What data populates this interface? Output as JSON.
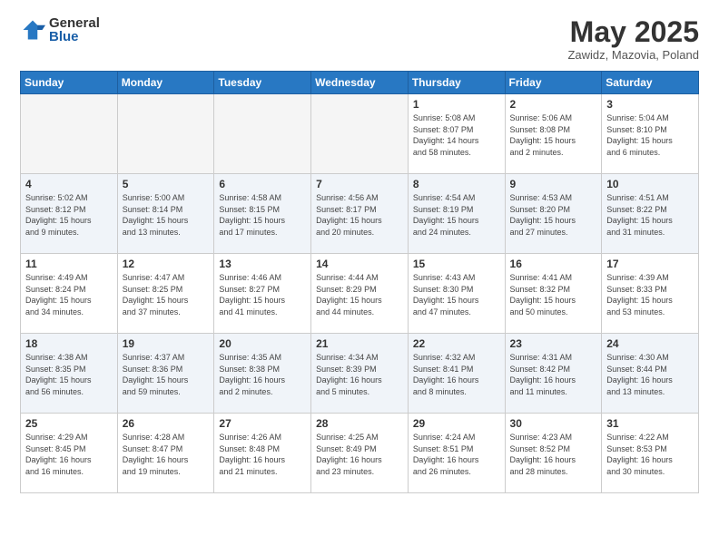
{
  "logo": {
    "general": "General",
    "blue": "Blue"
  },
  "title": "May 2025",
  "subtitle": "Zawidz, Mazovia, Poland",
  "days_header": [
    "Sunday",
    "Monday",
    "Tuesday",
    "Wednesday",
    "Thursday",
    "Friday",
    "Saturday"
  ],
  "weeks": [
    [
      {
        "day": "",
        "info": "",
        "empty": true
      },
      {
        "day": "",
        "info": "",
        "empty": true
      },
      {
        "day": "",
        "info": "",
        "empty": true
      },
      {
        "day": "",
        "info": "",
        "empty": true
      },
      {
        "day": "1",
        "info": "Sunrise: 5:08 AM\nSunset: 8:07 PM\nDaylight: 14 hours\nand 58 minutes.",
        "empty": false
      },
      {
        "day": "2",
        "info": "Sunrise: 5:06 AM\nSunset: 8:08 PM\nDaylight: 15 hours\nand 2 minutes.",
        "empty": false
      },
      {
        "day": "3",
        "info": "Sunrise: 5:04 AM\nSunset: 8:10 PM\nDaylight: 15 hours\nand 6 minutes.",
        "empty": false
      }
    ],
    [
      {
        "day": "4",
        "info": "Sunrise: 5:02 AM\nSunset: 8:12 PM\nDaylight: 15 hours\nand 9 minutes.",
        "empty": false
      },
      {
        "day": "5",
        "info": "Sunrise: 5:00 AM\nSunset: 8:14 PM\nDaylight: 15 hours\nand 13 minutes.",
        "empty": false
      },
      {
        "day": "6",
        "info": "Sunrise: 4:58 AM\nSunset: 8:15 PM\nDaylight: 15 hours\nand 17 minutes.",
        "empty": false
      },
      {
        "day": "7",
        "info": "Sunrise: 4:56 AM\nSunset: 8:17 PM\nDaylight: 15 hours\nand 20 minutes.",
        "empty": false
      },
      {
        "day": "8",
        "info": "Sunrise: 4:54 AM\nSunset: 8:19 PM\nDaylight: 15 hours\nand 24 minutes.",
        "empty": false
      },
      {
        "day": "9",
        "info": "Sunrise: 4:53 AM\nSunset: 8:20 PM\nDaylight: 15 hours\nand 27 minutes.",
        "empty": false
      },
      {
        "day": "10",
        "info": "Sunrise: 4:51 AM\nSunset: 8:22 PM\nDaylight: 15 hours\nand 31 minutes.",
        "empty": false
      }
    ],
    [
      {
        "day": "11",
        "info": "Sunrise: 4:49 AM\nSunset: 8:24 PM\nDaylight: 15 hours\nand 34 minutes.",
        "empty": false
      },
      {
        "day": "12",
        "info": "Sunrise: 4:47 AM\nSunset: 8:25 PM\nDaylight: 15 hours\nand 37 minutes.",
        "empty": false
      },
      {
        "day": "13",
        "info": "Sunrise: 4:46 AM\nSunset: 8:27 PM\nDaylight: 15 hours\nand 41 minutes.",
        "empty": false
      },
      {
        "day": "14",
        "info": "Sunrise: 4:44 AM\nSunset: 8:29 PM\nDaylight: 15 hours\nand 44 minutes.",
        "empty": false
      },
      {
        "day": "15",
        "info": "Sunrise: 4:43 AM\nSunset: 8:30 PM\nDaylight: 15 hours\nand 47 minutes.",
        "empty": false
      },
      {
        "day": "16",
        "info": "Sunrise: 4:41 AM\nSunset: 8:32 PM\nDaylight: 15 hours\nand 50 minutes.",
        "empty": false
      },
      {
        "day": "17",
        "info": "Sunrise: 4:39 AM\nSunset: 8:33 PM\nDaylight: 15 hours\nand 53 minutes.",
        "empty": false
      }
    ],
    [
      {
        "day": "18",
        "info": "Sunrise: 4:38 AM\nSunset: 8:35 PM\nDaylight: 15 hours\nand 56 minutes.",
        "empty": false
      },
      {
        "day": "19",
        "info": "Sunrise: 4:37 AM\nSunset: 8:36 PM\nDaylight: 15 hours\nand 59 minutes.",
        "empty": false
      },
      {
        "day": "20",
        "info": "Sunrise: 4:35 AM\nSunset: 8:38 PM\nDaylight: 16 hours\nand 2 minutes.",
        "empty": false
      },
      {
        "day": "21",
        "info": "Sunrise: 4:34 AM\nSunset: 8:39 PM\nDaylight: 16 hours\nand 5 minutes.",
        "empty": false
      },
      {
        "day": "22",
        "info": "Sunrise: 4:32 AM\nSunset: 8:41 PM\nDaylight: 16 hours\nand 8 minutes.",
        "empty": false
      },
      {
        "day": "23",
        "info": "Sunrise: 4:31 AM\nSunset: 8:42 PM\nDaylight: 16 hours\nand 11 minutes.",
        "empty": false
      },
      {
        "day": "24",
        "info": "Sunrise: 4:30 AM\nSunset: 8:44 PM\nDaylight: 16 hours\nand 13 minutes.",
        "empty": false
      }
    ],
    [
      {
        "day": "25",
        "info": "Sunrise: 4:29 AM\nSunset: 8:45 PM\nDaylight: 16 hours\nand 16 minutes.",
        "empty": false
      },
      {
        "day": "26",
        "info": "Sunrise: 4:28 AM\nSunset: 8:47 PM\nDaylight: 16 hours\nand 19 minutes.",
        "empty": false
      },
      {
        "day": "27",
        "info": "Sunrise: 4:26 AM\nSunset: 8:48 PM\nDaylight: 16 hours\nand 21 minutes.",
        "empty": false
      },
      {
        "day": "28",
        "info": "Sunrise: 4:25 AM\nSunset: 8:49 PM\nDaylight: 16 hours\nand 23 minutes.",
        "empty": false
      },
      {
        "day": "29",
        "info": "Sunrise: 4:24 AM\nSunset: 8:51 PM\nDaylight: 16 hours\nand 26 minutes.",
        "empty": false
      },
      {
        "day": "30",
        "info": "Sunrise: 4:23 AM\nSunset: 8:52 PM\nDaylight: 16 hours\nand 28 minutes.",
        "empty": false
      },
      {
        "day": "31",
        "info": "Sunrise: 4:22 AM\nSunset: 8:53 PM\nDaylight: 16 hours\nand 30 minutes.",
        "empty": false
      }
    ]
  ]
}
